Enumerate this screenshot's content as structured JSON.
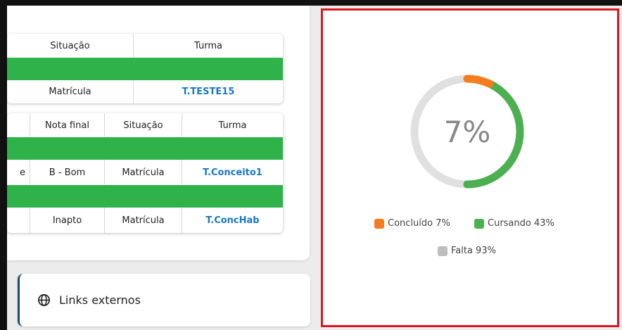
{
  "table1": {
    "headers": [
      "Situação",
      "Turma"
    ],
    "rows": [
      {
        "situacao": "Matrícula",
        "turma": "T.TESTE15"
      }
    ]
  },
  "table2": {
    "headers": [
      "Nota final",
      "Situação",
      "Turma"
    ],
    "rows": [
      {
        "lead": "e",
        "nota": "B - Bom",
        "situacao": "Matrícula",
        "turma": "T.Conceito1"
      },
      {
        "lead": "",
        "nota": "Inapto",
        "situacao": "Matrícula",
        "turma": "T.ConcHab"
      }
    ]
  },
  "links_externos": {
    "label": "Links externos",
    "icon": "globe-icon"
  },
  "progress": {
    "center_label": "7%",
    "legend": [
      {
        "label": "Concluído 7%",
        "color": "#f57c1f",
        "percent": 7
      },
      {
        "label": "Cursando 43%",
        "color": "#4caf50",
        "percent": 43
      },
      {
        "label": "Falta 93%",
        "color": "#bdbdbd",
        "percent": 93
      }
    ],
    "track_color": "#e0e0e0",
    "highlight_color": "#e0141c"
  }
}
